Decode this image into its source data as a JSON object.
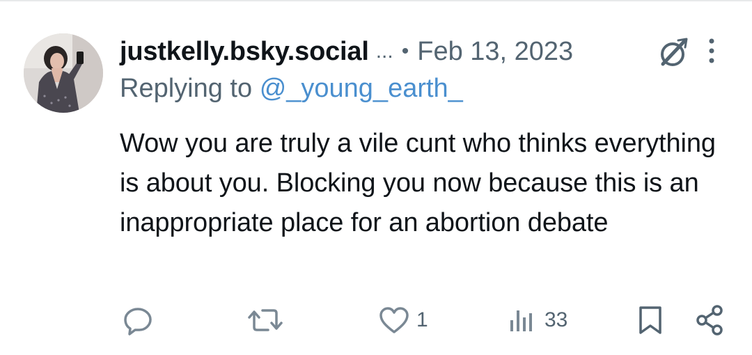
{
  "post": {
    "author_handle": "justkelly.bsky.social",
    "handle_truncation": "...",
    "separator": "•",
    "date": "Feb 13, 2023",
    "replying_prefix": "Replying to",
    "replying_to": "@_young_earth_",
    "text": "Wow you are truly a vile cunt who thinks everything is about you. Blocking you now because this is an inappropriate place for an abortion debate"
  },
  "actions": {
    "reply_icon": "reply-icon",
    "repost_icon": "repost-icon",
    "like_icon": "heart-icon",
    "like_count": "1",
    "views_icon": "views-icon",
    "views_count": "33",
    "bookmark_icon": "bookmark-icon",
    "share_icon": "share-icon"
  },
  "colors": {
    "text_primary": "#0f1419",
    "text_secondary": "#536471",
    "mention": "#4a8fcf",
    "divider": "#e7e9ea"
  }
}
